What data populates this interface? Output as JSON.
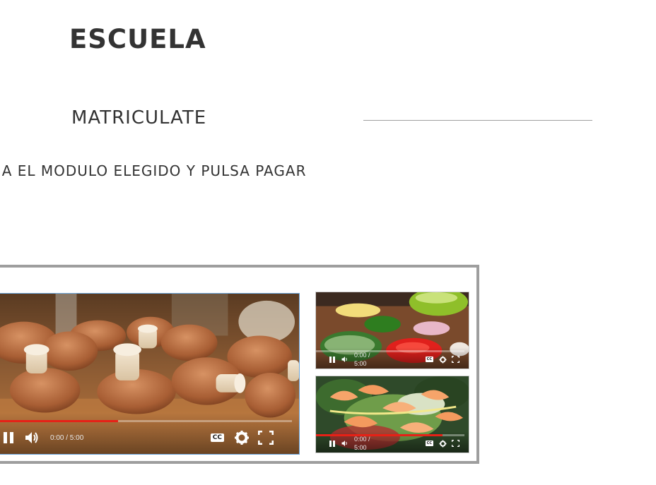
{
  "brand": "ESCUELA",
  "section_title": "MATRICULATE",
  "instruction": "ONA EL MODULO ELEGIDO Y PULSA PAGAR",
  "gallery": {
    "main_video": {
      "subject": "mushrooms",
      "time": "0:00 / 5:00",
      "progress": 0.42,
      "cc_label": "CC",
      "icons": [
        "pause-icon",
        "volume-icon",
        "cc-icon",
        "settings-icon",
        "fullscreen-icon"
      ]
    },
    "thumbnails": [
      {
        "subject": "chopped vegetables",
        "time": "0:00 / 5:00",
        "progress": 0.0,
        "cc_label": "CC"
      },
      {
        "subject": "shrimp salad",
        "time": "0:00 / 5:00",
        "progress": 0.85,
        "cc_label": "CC"
      }
    ]
  },
  "colors": {
    "text": "#333333",
    "divider": "#a0a0a0",
    "gallery_border": "#9e9e9e",
    "progress": "#e62117",
    "active_border": "#6ea8de"
  }
}
